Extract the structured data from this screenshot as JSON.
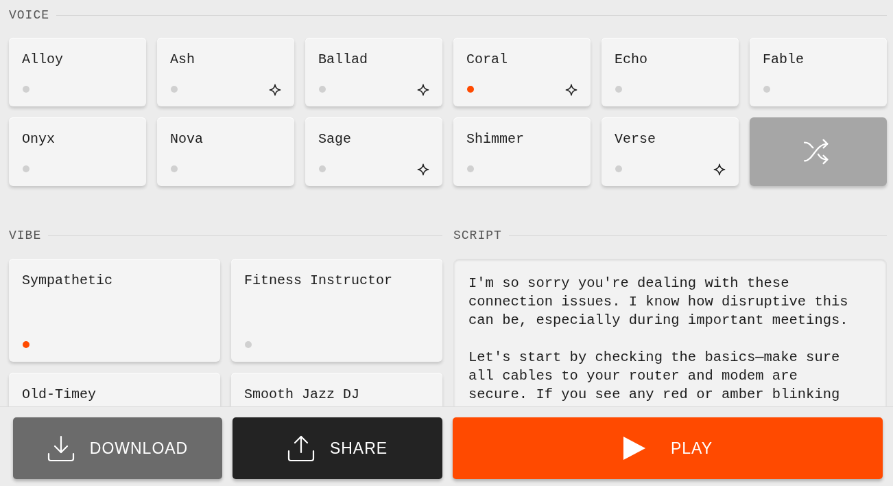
{
  "voice": {
    "heading": "VOICE",
    "items": [
      {
        "name": "Alloy",
        "selected": false,
        "sparkle": false
      },
      {
        "name": "Ash",
        "selected": false,
        "sparkle": true
      },
      {
        "name": "Ballad",
        "selected": false,
        "sparkle": true
      },
      {
        "name": "Coral",
        "selected": true,
        "sparkle": true
      },
      {
        "name": "Echo",
        "selected": false,
        "sparkle": false
      },
      {
        "name": "Fable",
        "selected": false,
        "sparkle": false
      },
      {
        "name": "Onyx",
        "selected": false,
        "sparkle": false
      },
      {
        "name": "Nova",
        "selected": false,
        "sparkle": false
      },
      {
        "name": "Sage",
        "selected": false,
        "sparkle": true
      },
      {
        "name": "Shimmer",
        "selected": false,
        "sparkle": false
      },
      {
        "name": "Verse",
        "selected": false,
        "sparkle": true
      }
    ]
  },
  "vibe": {
    "heading": "VIBE",
    "items": [
      {
        "name": "Sympathetic",
        "selected": true
      },
      {
        "name": "Fitness Instructor",
        "selected": false
      },
      {
        "name": "Old-Timey"
      },
      {
        "name": "Smooth Jazz DJ"
      }
    ]
  },
  "script": {
    "heading": "SCRIPT",
    "paragraphs": [
      "I'm so sorry you're dealing with these connection issues. I know how disruptive this can be, especially during important meetings.",
      "Let's start by checking the basics—make sure all cables to your router and modem are secure. If you see any red or amber blinking"
    ]
  },
  "actions": [
    {
      "kind": "download",
      "label": "DOWNLOAD"
    },
    {
      "kind": "share",
      "label": "SHARE"
    },
    {
      "kind": "play",
      "label": "PLAY"
    }
  ]
}
